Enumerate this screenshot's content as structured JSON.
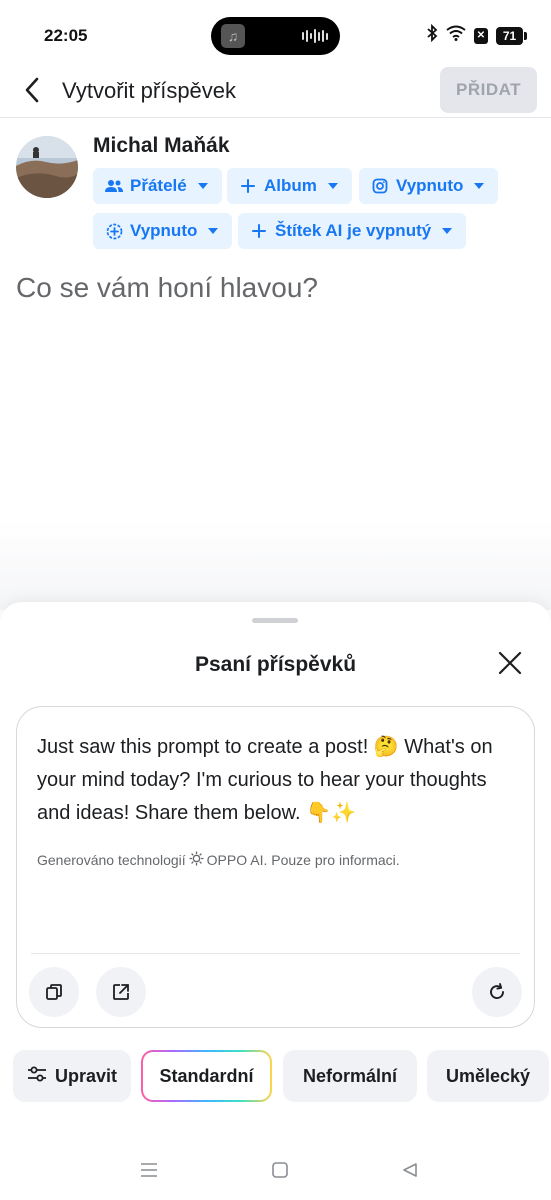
{
  "status_bar": {
    "time": "22:05",
    "battery": "71"
  },
  "header": {
    "title": "Vytvořit příspěvek",
    "add_label": "PŘIDAT"
  },
  "composer": {
    "user_name": "Michal Maňák",
    "chips": {
      "audience": "Přátelé",
      "album": "Album",
      "instagram": "Vypnuto",
      "sharing": "Vypnuto",
      "ai_label": "Štítek AI je vypnutý"
    },
    "placeholder": "Co se vám honí hlavou?"
  },
  "sheet": {
    "title": "Psaní příspěvků",
    "generated_text": "Just saw this prompt to create a post! 🤔 What's on your mind today? I'm curious to hear your thoughts and ideas! Share them below. 👇✨",
    "disclaimer_before": "Generováno technologií",
    "disclaimer_after": "OPPO AI. Pouze pro informaci.",
    "styles": {
      "edit": "Upravit",
      "standard": "Standardní",
      "informal": "Neformální",
      "artistic": "Umělecký"
    }
  },
  "colors": {
    "accent": "#1877f2",
    "chip_bg": "#e7f3ff"
  }
}
